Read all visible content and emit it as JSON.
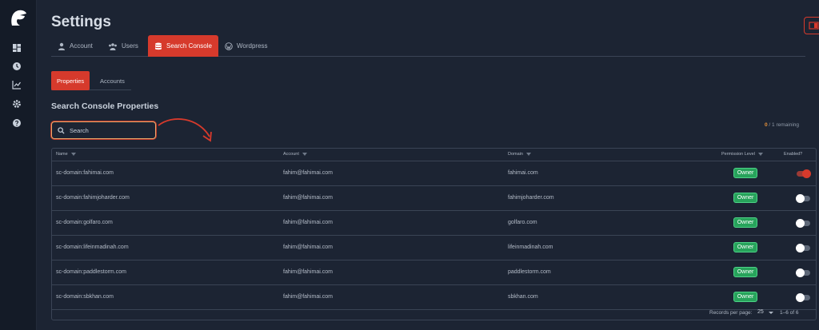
{
  "page": {
    "title": "Settings"
  },
  "tabs": [
    {
      "label": "Account",
      "icon": "person-icon",
      "active": false
    },
    {
      "label": "Users",
      "icon": "users-icon",
      "active": false
    },
    {
      "label": "Search Console",
      "icon": "database-icon",
      "active": true
    },
    {
      "label": "Wordpress",
      "icon": "wordpress-icon",
      "active": false
    }
  ],
  "subtabs": [
    {
      "label": "Properties",
      "active": true
    },
    {
      "label": "Accounts",
      "active": false
    }
  ],
  "section": {
    "title": "Search Console Properties"
  },
  "search": {
    "placeholder": "Search",
    "value": ""
  },
  "quota": {
    "used": "0",
    "total": " / 1 remaining"
  },
  "table": {
    "columns": [
      "Name",
      "Account",
      "Domain",
      "Permission Level",
      "Enabled?"
    ],
    "rows": [
      {
        "name": "sc-domain:fahimai.com",
        "account": "fahim@fahimai.com",
        "domain": "fahimai.com",
        "permission": "Owner",
        "enabled": true
      },
      {
        "name": "sc-domain:fahimjoharder.com",
        "account": "fahim@fahimai.com",
        "domain": "fahimjoharder.com",
        "permission": "Owner",
        "enabled": false
      },
      {
        "name": "sc-domain:golfaro.com",
        "account": "fahim@fahimai.com",
        "domain": "golfaro.com",
        "permission": "Owner",
        "enabled": false
      },
      {
        "name": "sc-domain:lifeinmadinah.com",
        "account": "fahim@fahimai.com",
        "domain": "lifeinmadinah.com",
        "permission": "Owner",
        "enabled": false
      },
      {
        "name": "sc-domain:paddlestorm.com",
        "account": "fahim@fahimai.com",
        "domain": "paddlestorm.com",
        "permission": "Owner",
        "enabled": false
      },
      {
        "name": "sc-domain:sbkhan.com",
        "account": "fahim@fahimai.com",
        "domain": "sbkhan.com",
        "permission": "Owner",
        "enabled": false
      }
    ],
    "footer": {
      "records_label": "Records per page:",
      "per_page": "25",
      "range": "1–6 of 6"
    }
  },
  "colors": {
    "accent": "#d63a2c",
    "badge": "#27a35b",
    "background": "#1c2433",
    "highlight": "#e8a76a"
  }
}
